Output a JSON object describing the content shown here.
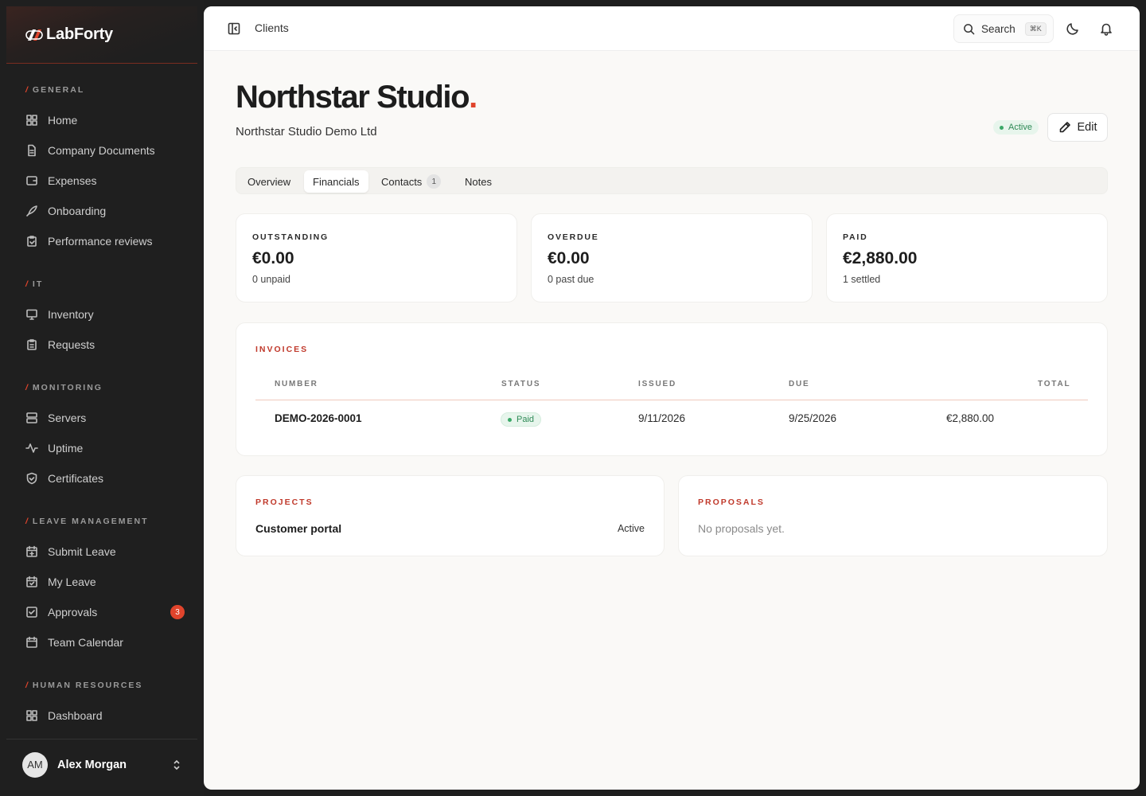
{
  "brand": {
    "name": "LabForty",
    "accent": "#e0442c"
  },
  "sidebar": {
    "sections": [
      {
        "title": "GENERAL",
        "items": [
          {
            "label": "Home",
            "icon": "grid-icon"
          },
          {
            "label": "Company Documents",
            "icon": "document-icon"
          },
          {
            "label": "Expenses",
            "icon": "wallet-icon"
          },
          {
            "label": "Onboarding",
            "icon": "rocket-icon"
          },
          {
            "label": "Performance reviews",
            "icon": "clipboard-icon"
          }
        ]
      },
      {
        "title": "IT",
        "items": [
          {
            "label": "Inventory",
            "icon": "monitor-icon"
          },
          {
            "label": "Requests",
            "icon": "clipboard-list-icon"
          }
        ]
      },
      {
        "title": "MONITORING",
        "items": [
          {
            "label": "Servers",
            "icon": "server-icon"
          },
          {
            "label": "Uptime",
            "icon": "activity-icon"
          },
          {
            "label": "Certificates",
            "icon": "shield-icon"
          }
        ]
      },
      {
        "title": "LEAVE MANAGEMENT",
        "items": [
          {
            "label": "Submit Leave",
            "icon": "calendar-plus-icon"
          },
          {
            "label": "My Leave",
            "icon": "calendar-check-icon"
          },
          {
            "label": "Approvals",
            "icon": "check-square-icon",
            "badge": "3"
          },
          {
            "label": "Team Calendar",
            "icon": "calendar-icon"
          }
        ]
      },
      {
        "title": "HUMAN RESOURCES",
        "items": [
          {
            "label": "Dashboard",
            "icon": "grid-icon"
          }
        ]
      }
    ],
    "user": {
      "initials": "AM",
      "name": "Alex Morgan"
    }
  },
  "topbar": {
    "breadcrumb": "Clients",
    "search_label": "Search",
    "search_shortcut": "⌘K"
  },
  "client": {
    "name": "Northstar Studio",
    "title_dot": ".",
    "legal_name": "Northstar Studio Demo Ltd",
    "status": "Active",
    "edit_label": "Edit"
  },
  "tabs": [
    {
      "label": "Overview"
    },
    {
      "label": "Financials",
      "active": true
    },
    {
      "label": "Contacts",
      "count": "1"
    },
    {
      "label": "Notes"
    }
  ],
  "stats": [
    {
      "label": "OUTSTANDING",
      "value": "€0.00",
      "note": "0 unpaid"
    },
    {
      "label": "OVERDUE",
      "value": "€0.00",
      "note": "0 past due"
    },
    {
      "label": "PAID",
      "value": "€2,880.00",
      "note": "1 settled"
    }
  ],
  "invoices": {
    "title": "INVOICES",
    "columns": [
      "NUMBER",
      "STATUS",
      "ISSUED",
      "DUE",
      "TOTAL"
    ],
    "rows": [
      {
        "number": "DEMO-2026-0001",
        "status": "Paid",
        "issued": "9/11/2026",
        "due": "9/25/2026",
        "total": "€2,880.00"
      }
    ]
  },
  "projects": {
    "title": "PROJECTS",
    "items": [
      {
        "name": "Customer portal",
        "status": "Active"
      }
    ]
  },
  "proposals": {
    "title": "PROPOSALS",
    "empty": "No proposals yet."
  }
}
